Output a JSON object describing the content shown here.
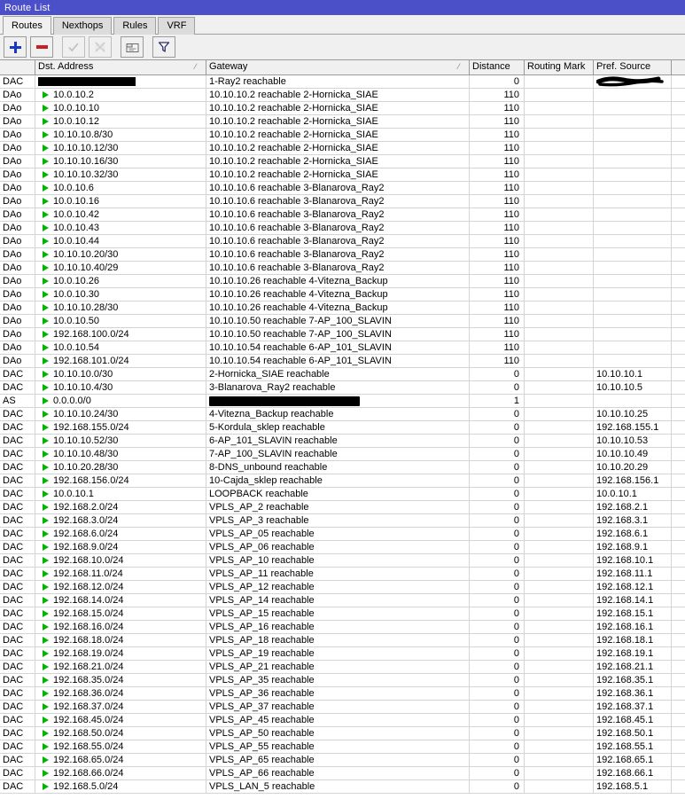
{
  "window": {
    "title": "Route List"
  },
  "tabs": [
    {
      "label": "Routes",
      "active": true
    },
    {
      "label": "Nexthops",
      "active": false
    },
    {
      "label": "Rules",
      "active": false
    },
    {
      "label": "VRF",
      "active": false
    }
  ],
  "toolbar": {
    "add_label": "+",
    "remove_label": "-",
    "enable_label": "enable",
    "disable_label": "disable",
    "comment_label": "comment",
    "filter_label": "filter"
  },
  "columns": [
    {
      "key": "flags",
      "label": ""
    },
    {
      "key": "dst",
      "label": "Dst. Address",
      "sorted": true
    },
    {
      "key": "gateway",
      "label": "Gateway",
      "sorted": true
    },
    {
      "key": "distance",
      "label": "Distance"
    },
    {
      "key": "routing_mark",
      "label": "Routing Mark"
    },
    {
      "key": "pref_source",
      "label": "Pref. Source"
    }
  ],
  "rows": [
    {
      "flags": "DAC",
      "dst": "",
      "dst_redacted": 110,
      "gateway": "1-Ray2 reachable",
      "distance": "0",
      "routing_mark": "",
      "pref_source": "",
      "pref_redacted": true
    },
    {
      "flags": "DAo",
      "dst": "10.0.10.2",
      "gateway": "10.10.10.2 reachable 2-Hornicka_SIAE",
      "distance": "110",
      "routing_mark": "",
      "pref_source": ""
    },
    {
      "flags": "DAo",
      "dst": "10.0.10.10",
      "gateway": "10.10.10.2 reachable 2-Hornicka_SIAE",
      "distance": "110",
      "routing_mark": "",
      "pref_source": ""
    },
    {
      "flags": "DAo",
      "dst": "10.0.10.12",
      "gateway": "10.10.10.2 reachable 2-Hornicka_SIAE",
      "distance": "110",
      "routing_mark": "",
      "pref_source": ""
    },
    {
      "flags": "DAo",
      "dst": "10.10.10.8/30",
      "gateway": "10.10.10.2 reachable 2-Hornicka_SIAE",
      "distance": "110",
      "routing_mark": "",
      "pref_source": ""
    },
    {
      "flags": "DAo",
      "dst": "10.10.10.12/30",
      "gateway": "10.10.10.2 reachable 2-Hornicka_SIAE",
      "distance": "110",
      "routing_mark": "",
      "pref_source": ""
    },
    {
      "flags": "DAo",
      "dst": "10.10.10.16/30",
      "gateway": "10.10.10.2 reachable 2-Hornicka_SIAE",
      "distance": "110",
      "routing_mark": "",
      "pref_source": ""
    },
    {
      "flags": "DAo",
      "dst": "10.10.10.32/30",
      "gateway": "10.10.10.2 reachable 2-Hornicka_SIAE",
      "distance": "110",
      "routing_mark": "",
      "pref_source": ""
    },
    {
      "flags": "DAo",
      "dst": "10.0.10.6",
      "gateway": "10.10.10.6 reachable 3-Blanarova_Ray2",
      "distance": "110",
      "routing_mark": "",
      "pref_source": ""
    },
    {
      "flags": "DAo",
      "dst": "10.0.10.16",
      "gateway": "10.10.10.6 reachable 3-Blanarova_Ray2",
      "distance": "110",
      "routing_mark": "",
      "pref_source": ""
    },
    {
      "flags": "DAo",
      "dst": "10.0.10.42",
      "gateway": "10.10.10.6 reachable 3-Blanarova_Ray2",
      "distance": "110",
      "routing_mark": "",
      "pref_source": ""
    },
    {
      "flags": "DAo",
      "dst": "10.0.10.43",
      "gateway": "10.10.10.6 reachable 3-Blanarova_Ray2",
      "distance": "110",
      "routing_mark": "",
      "pref_source": ""
    },
    {
      "flags": "DAo",
      "dst": "10.0.10.44",
      "gateway": "10.10.10.6 reachable 3-Blanarova_Ray2",
      "distance": "110",
      "routing_mark": "",
      "pref_source": ""
    },
    {
      "flags": "DAo",
      "dst": "10.10.10.20/30",
      "gateway": "10.10.10.6 reachable 3-Blanarova_Ray2",
      "distance": "110",
      "routing_mark": "",
      "pref_source": ""
    },
    {
      "flags": "DAo",
      "dst": "10.10.10.40/29",
      "gateway": "10.10.10.6 reachable 3-Blanarova_Ray2",
      "distance": "110",
      "routing_mark": "",
      "pref_source": ""
    },
    {
      "flags": "DAo",
      "dst": "10.0.10.26",
      "gateway": "10.10.10.26 reachable 4-Vitezna_Backup",
      "distance": "110",
      "routing_mark": "",
      "pref_source": ""
    },
    {
      "flags": "DAo",
      "dst": "10.0.10.30",
      "gateway": "10.10.10.26 reachable 4-Vitezna_Backup",
      "distance": "110",
      "routing_mark": "",
      "pref_source": ""
    },
    {
      "flags": "DAo",
      "dst": "10.10.10.28/30",
      "gateway": "10.10.10.26 reachable 4-Vitezna_Backup",
      "distance": "110",
      "routing_mark": "",
      "pref_source": ""
    },
    {
      "flags": "DAo",
      "dst": "10.0.10.50",
      "gateway": "10.10.10.50 reachable 7-AP_100_SLAVIN",
      "distance": "110",
      "routing_mark": "",
      "pref_source": ""
    },
    {
      "flags": "DAo",
      "dst": "192.168.100.0/24",
      "gateway": "10.10.10.50 reachable 7-AP_100_SLAVIN",
      "distance": "110",
      "routing_mark": "",
      "pref_source": ""
    },
    {
      "flags": "DAo",
      "dst": "10.0.10.54",
      "gateway": "10.10.10.54 reachable 6-AP_101_SLAVIN",
      "distance": "110",
      "routing_mark": "",
      "pref_source": ""
    },
    {
      "flags": "DAo",
      "dst": "192.168.101.0/24",
      "gateway": "10.10.10.54 reachable 6-AP_101_SLAVIN",
      "distance": "110",
      "routing_mark": "",
      "pref_source": ""
    },
    {
      "flags": "DAC",
      "dst": "10.10.10.0/30",
      "gateway": "2-Hornicka_SIAE reachable",
      "distance": "0",
      "routing_mark": "",
      "pref_source": "10.10.10.1"
    },
    {
      "flags": "DAC",
      "dst": "10.10.10.4/30",
      "gateway": "3-Blanarova_Ray2 reachable",
      "distance": "0",
      "routing_mark": "",
      "pref_source": "10.10.10.5"
    },
    {
      "flags": "AS",
      "dst": "0.0.0.0/0",
      "gateway": "",
      "gw_redacted": 170,
      "distance": "1",
      "routing_mark": "",
      "pref_source": ""
    },
    {
      "flags": "DAC",
      "dst": "10.10.10.24/30",
      "gateway": "4-Vitezna_Backup reachable",
      "distance": "0",
      "routing_mark": "",
      "pref_source": "10.10.10.25"
    },
    {
      "flags": "DAC",
      "dst": "192.168.155.0/24",
      "gateway": "5-Kordula_sklep reachable",
      "distance": "0",
      "routing_mark": "",
      "pref_source": "192.168.155.1"
    },
    {
      "flags": "DAC",
      "dst": "10.10.10.52/30",
      "gateway": "6-AP_101_SLAVIN reachable",
      "distance": "0",
      "routing_mark": "",
      "pref_source": "10.10.10.53"
    },
    {
      "flags": "DAC",
      "dst": "10.10.10.48/30",
      "gateway": "7-AP_100_SLAVIN reachable",
      "distance": "0",
      "routing_mark": "",
      "pref_source": "10.10.10.49"
    },
    {
      "flags": "DAC",
      "dst": "10.10.20.28/30",
      "gateway": "8-DNS_unbound reachable",
      "distance": "0",
      "routing_mark": "",
      "pref_source": "10.10.20.29"
    },
    {
      "flags": "DAC",
      "dst": "192.168.156.0/24",
      "gateway": "10-Cajda_sklep reachable",
      "distance": "0",
      "routing_mark": "",
      "pref_source": "192.168.156.1"
    },
    {
      "flags": "DAC",
      "dst": "10.0.10.1",
      "gateway": "LOOPBACK reachable",
      "distance": "0",
      "routing_mark": "",
      "pref_source": "10.0.10.1"
    },
    {
      "flags": "DAC",
      "dst": "192.168.2.0/24",
      "gateway": "VPLS_AP_2 reachable",
      "distance": "0",
      "routing_mark": "",
      "pref_source": "192.168.2.1"
    },
    {
      "flags": "DAC",
      "dst": "192.168.3.0/24",
      "gateway": "VPLS_AP_3 reachable",
      "distance": "0",
      "routing_mark": "",
      "pref_source": "192.168.3.1"
    },
    {
      "flags": "DAC",
      "dst": "192.168.6.0/24",
      "gateway": "VPLS_AP_05 reachable",
      "distance": "0",
      "routing_mark": "",
      "pref_source": "192.168.6.1"
    },
    {
      "flags": "DAC",
      "dst": "192.168.9.0/24",
      "gateway": "VPLS_AP_06 reachable",
      "distance": "0",
      "routing_mark": "",
      "pref_source": "192.168.9.1"
    },
    {
      "flags": "DAC",
      "dst": "192.168.10.0/24",
      "gateway": "VPLS_AP_10 reachable",
      "distance": "0",
      "routing_mark": "",
      "pref_source": "192.168.10.1"
    },
    {
      "flags": "DAC",
      "dst": "192.168.11.0/24",
      "gateway": "VPLS_AP_11 reachable",
      "distance": "0",
      "routing_mark": "",
      "pref_source": "192.168.11.1"
    },
    {
      "flags": "DAC",
      "dst": "192.168.12.0/24",
      "gateway": "VPLS_AP_12 reachable",
      "distance": "0",
      "routing_mark": "",
      "pref_source": "192.168.12.1"
    },
    {
      "flags": "DAC",
      "dst": "192.168.14.0/24",
      "gateway": "VPLS_AP_14 reachable",
      "distance": "0",
      "routing_mark": "",
      "pref_source": "192.168.14.1"
    },
    {
      "flags": "DAC",
      "dst": "192.168.15.0/24",
      "gateway": "VPLS_AP_15 reachable",
      "distance": "0",
      "routing_mark": "",
      "pref_source": "192.168.15.1"
    },
    {
      "flags": "DAC",
      "dst": "192.168.16.0/24",
      "gateway": "VPLS_AP_16 reachable",
      "distance": "0",
      "routing_mark": "",
      "pref_source": "192.168.16.1"
    },
    {
      "flags": "DAC",
      "dst": "192.168.18.0/24",
      "gateway": "VPLS_AP_18 reachable",
      "distance": "0",
      "routing_mark": "",
      "pref_source": "192.168.18.1"
    },
    {
      "flags": "DAC",
      "dst": "192.168.19.0/24",
      "gateway": "VPLS_AP_19 reachable",
      "distance": "0",
      "routing_mark": "",
      "pref_source": "192.168.19.1"
    },
    {
      "flags": "DAC",
      "dst": "192.168.21.0/24",
      "gateway": "VPLS_AP_21 reachable",
      "distance": "0",
      "routing_mark": "",
      "pref_source": "192.168.21.1"
    },
    {
      "flags": "DAC",
      "dst": "192.168.35.0/24",
      "gateway": "VPLS_AP_35 reachable",
      "distance": "0",
      "routing_mark": "",
      "pref_source": "192.168.35.1"
    },
    {
      "flags": "DAC",
      "dst": "192.168.36.0/24",
      "gateway": "VPLS_AP_36 reachable",
      "distance": "0",
      "routing_mark": "",
      "pref_source": "192.168.36.1"
    },
    {
      "flags": "DAC",
      "dst": "192.168.37.0/24",
      "gateway": "VPLS_AP_37 reachable",
      "distance": "0",
      "routing_mark": "",
      "pref_source": "192.168.37.1"
    },
    {
      "flags": "DAC",
      "dst": "192.168.45.0/24",
      "gateway": "VPLS_AP_45 reachable",
      "distance": "0",
      "routing_mark": "",
      "pref_source": "192.168.45.1"
    },
    {
      "flags": "DAC",
      "dst": "192.168.50.0/24",
      "gateway": "VPLS_AP_50 reachable",
      "distance": "0",
      "routing_mark": "",
      "pref_source": "192.168.50.1"
    },
    {
      "flags": "DAC",
      "dst": "192.168.55.0/24",
      "gateway": "VPLS_AP_55 reachable",
      "distance": "0",
      "routing_mark": "",
      "pref_source": "192.168.55.1"
    },
    {
      "flags": "DAC",
      "dst": "192.168.65.0/24",
      "gateway": "VPLS_AP_65 reachable",
      "distance": "0",
      "routing_mark": "",
      "pref_source": "192.168.65.1"
    },
    {
      "flags": "DAC",
      "dst": "192.168.66.0/24",
      "gateway": "VPLS_AP_66 reachable",
      "distance": "0",
      "routing_mark": "",
      "pref_source": "192.168.66.1"
    },
    {
      "flags": "DAC",
      "dst": "192.168.5.0/24",
      "gateway": "VPLS_LAN_5 reachable",
      "distance": "0",
      "routing_mark": "",
      "pref_source": "192.168.5.1"
    }
  ],
  "colors": {
    "titlebar": "#4b4fc8",
    "chrome": "#f0f0f0",
    "arrow_green": "#00b400",
    "plus_blue": "#1b36c4",
    "minus_red": "#c62020"
  }
}
